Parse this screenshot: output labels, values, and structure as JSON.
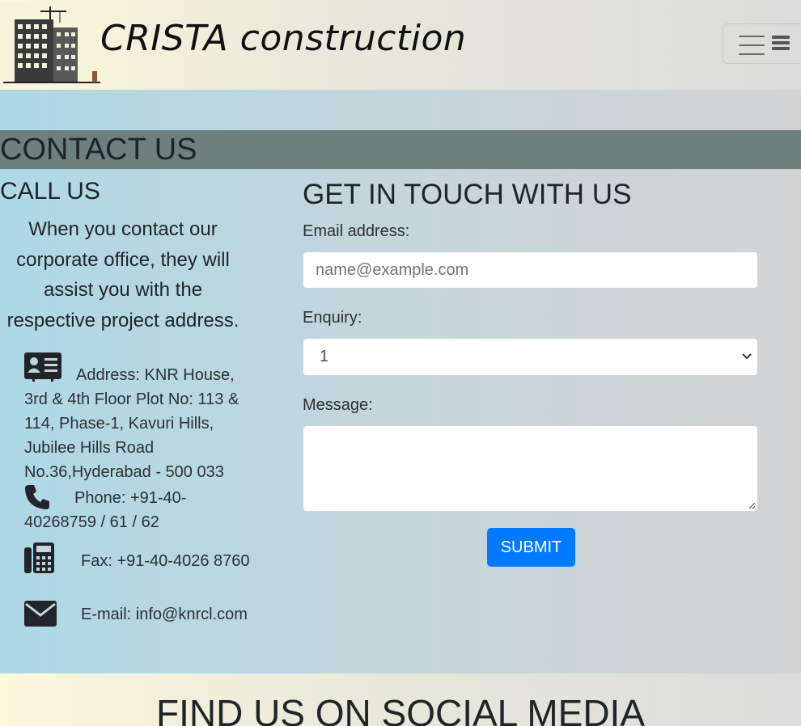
{
  "header": {
    "brand": "CRISTA construction"
  },
  "contact": {
    "title": "CONTACT US",
    "call_heading": "CALL US",
    "call_description": "When you contact our corporate office, they will assist you with the respective project address.",
    "address": "Address: KNR House, 3rd & 4th Floor Plot No: 113 & 114, Phase-1, Kavuri Hills, Jubilee Hills Road No.36,Hyderabad - 500 033",
    "phone": "Phone: +91-40-40268759 / 61 / 62",
    "fax": "Fax: +91-40-4026 8760",
    "email": "E-mail: info@knrcl.com"
  },
  "form": {
    "heading": "GET IN TOUCH WITH US",
    "email_label": "Email address:",
    "email_placeholder": "name@example.com",
    "enquiry_label": "Enquiry:",
    "enquiry_value": "1",
    "message_label": "Message:",
    "submit_label": "SUBMIT"
  },
  "social": {
    "title": "FIND US ON SOCIAL MEDIA"
  },
  "icons": {
    "logo": "building-crane-logo",
    "address": "address-card-icon",
    "phone": "phone-icon",
    "fax": "fax-icon",
    "email": "envelope-icon"
  },
  "colors": {
    "accent": "#007bff",
    "contact_bar": "#6e807e"
  }
}
